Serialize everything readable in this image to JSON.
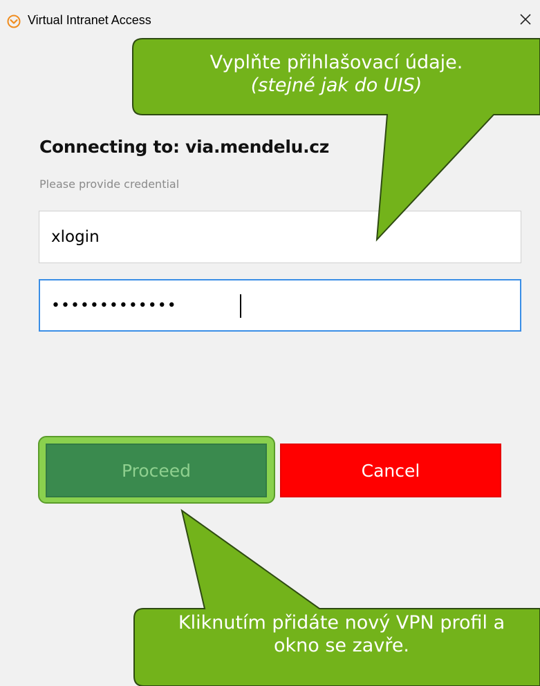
{
  "window": {
    "title": "Virtual Intranet Access",
    "icon": "via-logo-icon",
    "close_symbol": "✕"
  },
  "dialog": {
    "heading": "Connecting to: via.mendelu.cz",
    "subheading": "Please provide credential",
    "username": {
      "value": "xlogin"
    },
    "password": {
      "masked_value": "•••••••••••••"
    },
    "proceed_label": "Proceed",
    "cancel_label": "Cancel"
  },
  "callouts": {
    "top": {
      "line1": "Vyplňte přihlašovací údaje.",
      "line2": "(stejné jak do UIS)"
    },
    "bottom": {
      "line1": "Kliknutím přidáte nový VPN profil a",
      "line2": "okno se zavře."
    }
  },
  "colors": {
    "callout_fill": "#73b31b",
    "callout_border": "#2e4a12",
    "proceed_bg": "#3a8a4e",
    "proceed_highlight": "#8ad14e",
    "cancel_bg": "#ff0000",
    "focus_border": "#3a8ee6",
    "app_icon": "#f08c1e"
  }
}
